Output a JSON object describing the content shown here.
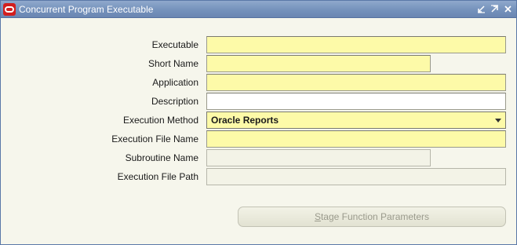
{
  "window": {
    "title": "Concurrent Program Executable",
    "logo_icon": "oracle-logo-icon",
    "controls": [
      "minimize-icon",
      "maximize-icon",
      "close-icon"
    ]
  },
  "form": {
    "executable": {
      "label": "Executable",
      "value": ""
    },
    "short_name": {
      "label": "Short Name",
      "value": ""
    },
    "application": {
      "label": "Application",
      "value": ""
    },
    "description": {
      "label": "Description",
      "value": ""
    },
    "execution_method": {
      "label": "Execution Method",
      "value": "Oracle Reports"
    },
    "execution_file_name": {
      "label": "Execution File Name",
      "value": ""
    },
    "subroutine_name": {
      "label": "Subroutine Name",
      "value": ""
    },
    "execution_file_path": {
      "label": "Execution File Path",
      "value": ""
    }
  },
  "buttons": {
    "stage_function_parameters": {
      "mnemonic": "S",
      "rest": "tage Function Parameters"
    }
  },
  "colors": {
    "titlebar": "#7592bc",
    "required_field": "#fdfaa8",
    "background": "#f6f6ec"
  }
}
